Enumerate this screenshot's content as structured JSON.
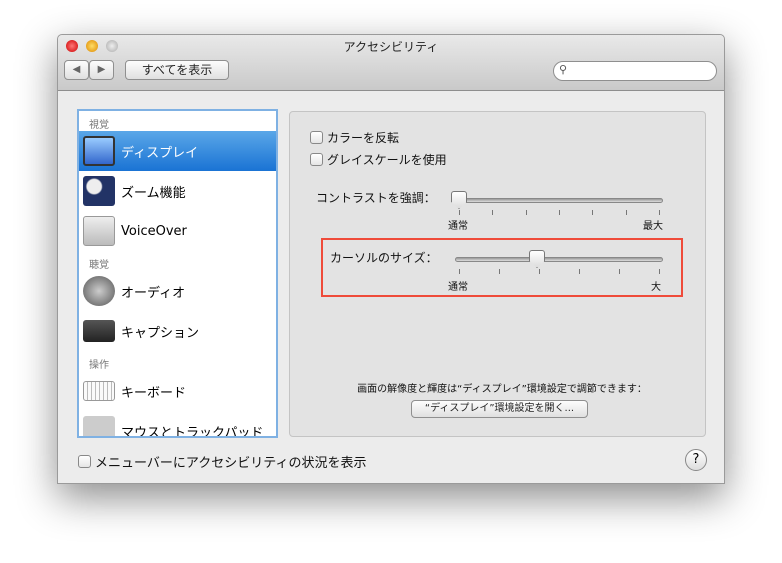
{
  "window": {
    "title": "アクセシビリティ"
  },
  "toolbar": {
    "back": "◀",
    "forward": "▶",
    "show_all": "すべてを表示",
    "search_placeholder": ""
  },
  "sidebar": {
    "groups": [
      {
        "header": "視覚",
        "items": [
          {
            "label": "ディスプレイ",
            "selected": true
          },
          {
            "label": "ズーム機能"
          },
          {
            "label": "VoiceOver"
          }
        ]
      },
      {
        "header": "聴覚",
        "items": [
          {
            "label": "オーディオ"
          },
          {
            "label": "キャプション"
          }
        ]
      },
      {
        "header": "操作",
        "items": [
          {
            "label": "キーボード"
          },
          {
            "label": "マウスとトラックパッド"
          }
        ]
      }
    ]
  },
  "display": {
    "invert_colors": "カラーを反転",
    "grayscale": "グレイスケールを使用",
    "contrast": {
      "label": "コントラストを強調：",
      "min": "通常",
      "max": "最大",
      "value": 0
    },
    "cursor": {
      "label": "カーソルのサイズ：",
      "min": "通常",
      "max": "大",
      "value": 0.39
    },
    "note": "画面の解像度と輝度は“ディスプレイ”環境設定で調節できます：",
    "open_display": "“ディスプレイ”環境設定を開く..."
  },
  "footer": {
    "show_menu": "メニューバーにアクセシビリティの状況を表示",
    "help": "?"
  }
}
